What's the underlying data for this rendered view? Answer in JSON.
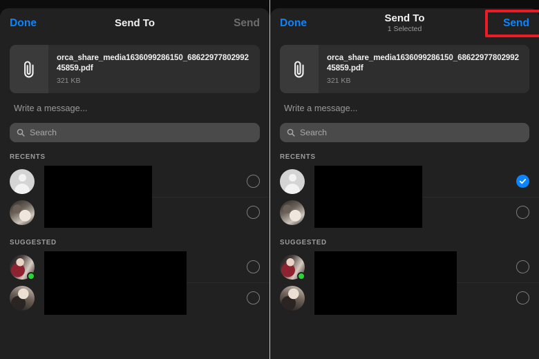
{
  "panels": [
    {
      "id": "before",
      "nav": {
        "done_label": "Done",
        "title": "Send To",
        "subtitle": "",
        "send_label": "Send",
        "send_enabled": false,
        "send_highlighted": false
      },
      "attachment": {
        "filename": "orca_share_media1636099286150_6862297780299245859.pdf",
        "filesize": "321 KB",
        "icon": "paperclip-icon"
      },
      "message": {
        "placeholder": "Write a message..."
      },
      "search": {
        "placeholder": "Search",
        "value": "",
        "icon": "search-icon"
      },
      "sections": [
        {
          "header": "RECENTS",
          "rows": [
            {
              "avatar": "default-person-avatar",
              "name_redacted": true,
              "online": false,
              "selected": false
            },
            {
              "avatar": "photo-avatar",
              "name_redacted": true,
              "online": false,
              "selected": false
            }
          ]
        },
        {
          "header": "SUGGESTED",
          "rows": [
            {
              "avatar": "photo-avatar",
              "name_redacted": true,
              "online": true,
              "selected": false
            },
            {
              "avatar": "photo-avatar",
              "name_redacted": true,
              "online": false,
              "selected": false
            }
          ]
        }
      ]
    },
    {
      "id": "after",
      "nav": {
        "done_label": "Done",
        "title": "Send To",
        "subtitle": "1 Selected",
        "send_label": "Send",
        "send_enabled": true,
        "send_highlighted": true
      },
      "attachment": {
        "filename": "orca_share_media1636099286150_6862297780299245859.pdf",
        "filesize": "321 KB",
        "icon": "paperclip-icon"
      },
      "message": {
        "placeholder": "Write a message..."
      },
      "search": {
        "placeholder": "Search",
        "value": "",
        "icon": "search-icon"
      },
      "sections": [
        {
          "header": "RECENTS",
          "rows": [
            {
              "avatar": "default-person-avatar",
              "name_redacted": true,
              "online": false,
              "selected": true
            },
            {
              "avatar": "photo-avatar",
              "name_redacted": true,
              "online": false,
              "selected": false
            }
          ]
        },
        {
          "header": "SUGGESTED",
          "rows": [
            {
              "avatar": "photo-avatar",
              "name_redacted": true,
              "online": true,
              "selected": false
            },
            {
              "avatar": "photo-avatar",
              "name_redacted": true,
              "online": false,
              "selected": false
            }
          ]
        }
      ]
    }
  ],
  "colors": {
    "accent_blue": "#0a84ff",
    "highlight_red": "#ec1c24",
    "sheet_background": "#212121",
    "card_background": "#2e2e2e",
    "search_background": "#4a4a4a",
    "online_green": "#2bd435",
    "disabled_gray": "#6d6d6d"
  }
}
